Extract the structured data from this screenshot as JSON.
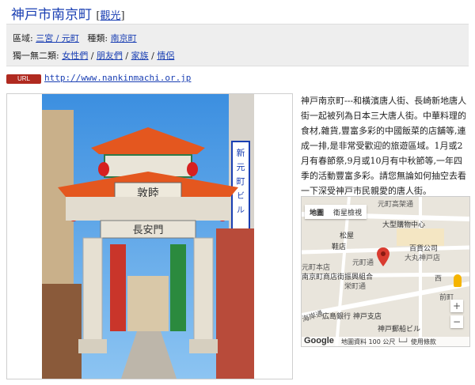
{
  "header": {
    "title": "神戸市南京町",
    "category_link": "觀光"
  },
  "info": {
    "region_label": "區域:",
    "region_link": "三宮 / 元町",
    "type_label": "種類:",
    "type_link": "南京町",
    "unique_label": "獨一無二類:",
    "unique_links": [
      "女性們",
      "朋友們",
      "家族",
      "情侶"
    ]
  },
  "url": {
    "badge": "URL",
    "link": "http://www.nankinmachi.or.jp"
  },
  "description": "神戸南京町---和橫濱唐人街、長崎新地唐人街一起被列為日本三大唐人街。中華料理的食材,雜貨,豐富多彩的中國飯菜的店舖等,連成一排,是非常受歡迎的旅遊區域。1月或2月有春節祭,9月或10月有中秋節等,一年四季的活動豐富多彩。請您無論如何抽空去看一下深受神戸市民親愛的唐人街。",
  "photo_signs": {
    "gate_plaque": "敦睦",
    "gate_sub": "長安門",
    "side_sign": "新元町ビル"
  },
  "map": {
    "tabs": [
      "地圖",
      "衛星檢視"
    ],
    "labels": {
      "l1": "元町高架通",
      "l2": "大型購物中心",
      "l3": "松屋",
      "l4": "鞋店",
      "l5": "百貨公司",
      "l6": "大丸神戸店",
      "l7": "元町通",
      "l8": "南京町商店街振興組合",
      "l9": "栄町通",
      "l10": "広島銀行 神戸支店",
      "l11": "神戸郵船ビル",
      "l12": "海岸通",
      "l13": "元町本店",
      "l14": "西",
      "l15": "前町"
    },
    "zoom_in": "+",
    "zoom_out": "−",
    "google": "Google",
    "footer": "地圖資料  100 公尺 └─┘  使用條款"
  },
  "colors": {
    "link": "#1a3fb3",
    "badge": "#b02a20",
    "info_bg": "#eeeeee",
    "pin": "#d93b30"
  }
}
